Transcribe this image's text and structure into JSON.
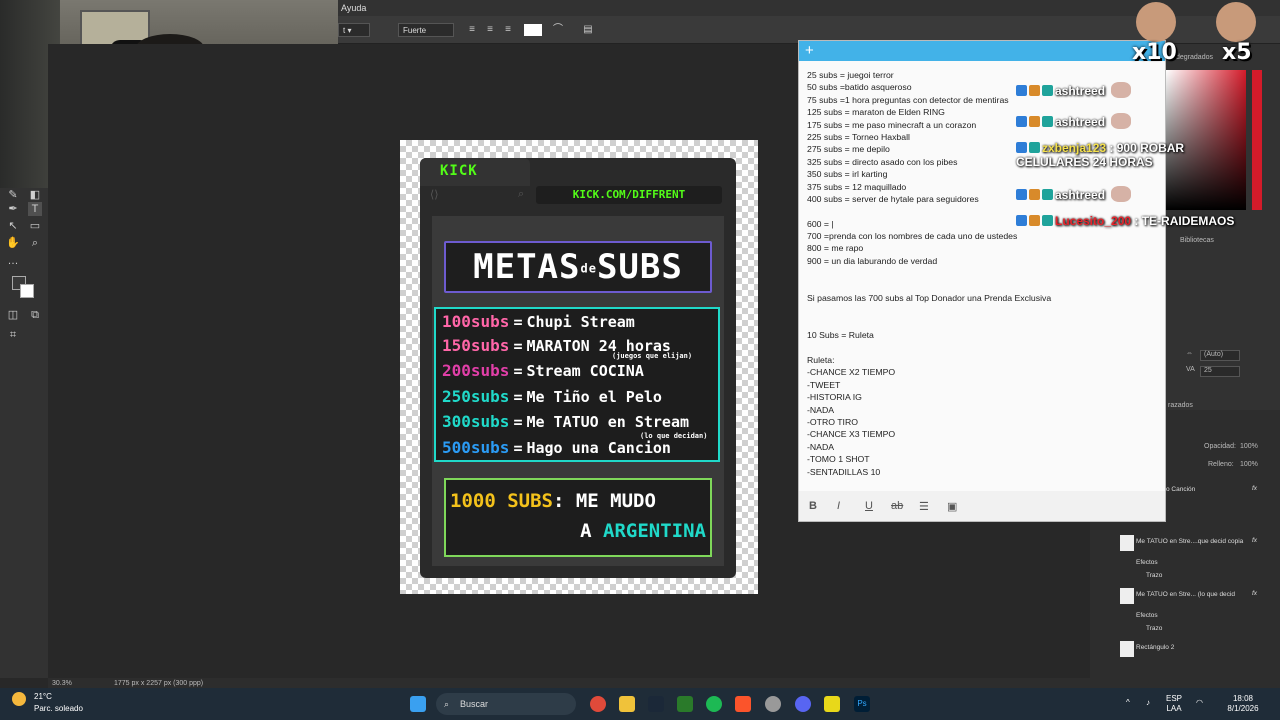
{
  "photoshop": {
    "menu_item": "Ayuda",
    "font_style": "Fuerte",
    "zoom": "30.3%",
    "doc_info": "1775 px x 2257 px (300 ppp)",
    "props": {
      "tracking": "(Auto)",
      "size": "25",
      "opacity_label": "Opacidad:",
      "opacity": "100%",
      "fill_label": "Relleno:",
      "fill": "100%",
      "tab_bibliotecas": "Bibliotecas",
      "tab_degradados": "degradados",
      "tab_trazados": "razados"
    },
    "layers": [
      {
        "name": "o Canción",
        "fx": "fx"
      },
      {
        "name": "Me TATUO en Stre....que decid copia",
        "fx": "fx"
      },
      {
        "name": "Efectos",
        "fx": ""
      },
      {
        "name": "Trazo",
        "fx": ""
      },
      {
        "name": "Me TATUO en Stre...  (lo que decid",
        "fx": "fx"
      },
      {
        "name": "Efectos",
        "fx": ""
      },
      {
        "name": "Trazo",
        "fx": ""
      },
      {
        "name": "Rectángulo 2",
        "fx": ""
      }
    ]
  },
  "poster": {
    "kick": "KICK",
    "url": "KICK.COM/DIFFRENT",
    "title_a": "METAS",
    "title_de": "de",
    "title_b": "SUBS",
    "goals": [
      {
        "num": "100subs",
        "eq": "=",
        "text": "Chupi Stream",
        "color": "#ff66a8"
      },
      {
        "num": "150subs",
        "eq": "=",
        "text": "MARATON 24 horas",
        "color": "#ff66a8"
      },
      {
        "num": "200subs",
        "eq": "=",
        "text": "Stream COCINA",
        "color": "#e13fa8"
      },
      {
        "num": "250subs",
        "eq": "=",
        "text": "Me Tiño el Pelo",
        "color": "#20d9c9"
      },
      {
        "num": "300subs",
        "eq": "=",
        "text": "Me TATUO en Stream",
        "color": "#20d9c9"
      },
      {
        "num": "500subs",
        "eq": "=",
        "text": "Hago una Cancion",
        "color": "#2b9bf4"
      }
    ],
    "note_150": "(juegos que elijan)",
    "note_300": "(lo que decidan)",
    "big_a": "1000 SUBS",
    "big_b": ": ME MUDO",
    "big_c": "A",
    "big_d": "ARGENTINA"
  },
  "note": {
    "lines": [
      "25 subs = juegoi terror",
      "50 subs =batido asqueroso",
      "75 subs =1 hora preguntas con detector de mentiras",
      "125 subs = maraton de Elden RING",
      "175 subs = me paso minecraft a un corazon",
      "225 subs = Torneo Haxball",
      "275 subs = me depilo",
      "325 subs = directo asado con los pibes",
      "350 subs = irl karting",
      "375 subs = 12 maquillado",
      "400 subs = server de hytale para seguidores",
      "",
      "600 = |",
      "700 =prenda con los nombres de cada uno de ustedes",
      "800 = me rapo",
      "900 = un dia laburando de verdad",
      "",
      "",
      "Si pasamos las 700 subs al Top Donador una Prenda Exclusiva",
      "",
      "",
      "10 Subs = Ruleta",
      "",
      "Ruleta:",
      "-CHANCE X2 TIEMPO",
      "-TWEET",
      "-HISTORIA IG",
      "-NADA",
      "-OTRO TIRO",
      "-CHANCE X3 TIEMPO",
      "-NADA",
      "-TOMO 1 SHOT",
      "-SENTADILLAS 10"
    ],
    "toolbar": {
      "bold": "B",
      "italic": "I",
      "underline": "U",
      "strike": "ab",
      "list": "☰",
      "image": "▣"
    }
  },
  "chat": [
    {
      "user": "ashtreed",
      "sep": ":",
      "msg": "",
      "user_color": "#ffffff"
    },
    {
      "user": "ashtreed",
      "sep": ":",
      "msg": "",
      "user_color": "#ffffff"
    },
    {
      "user": "zxbenja123",
      "sep": " : ",
      "msg": "900 ROBAR CELULARES 24 HORAS",
      "user_color": "#f4e04d"
    },
    {
      "user": "ashtreed",
      "sep": ":",
      "msg": "",
      "user_color": "#ffffff"
    },
    {
      "user": "Lucesito_200",
      "sep": " : ",
      "msg": "TE-RAIDEMAOS",
      "user_color": "#e8242c"
    }
  ],
  "stickers": [
    {
      "mult": "x10"
    },
    {
      "mult": "x5"
    }
  ],
  "taskbar": {
    "temp": "21°C",
    "weather": "Parc. soleado",
    "search": "Buscar",
    "lang1": "ESP",
    "lang2": "LAA",
    "time": "18:08",
    "date": "8/1/2026"
  },
  "colors": {
    "kick_green": "#53fc18",
    "note_header": "#42b2e8",
    "ps_bg": "#282828"
  }
}
